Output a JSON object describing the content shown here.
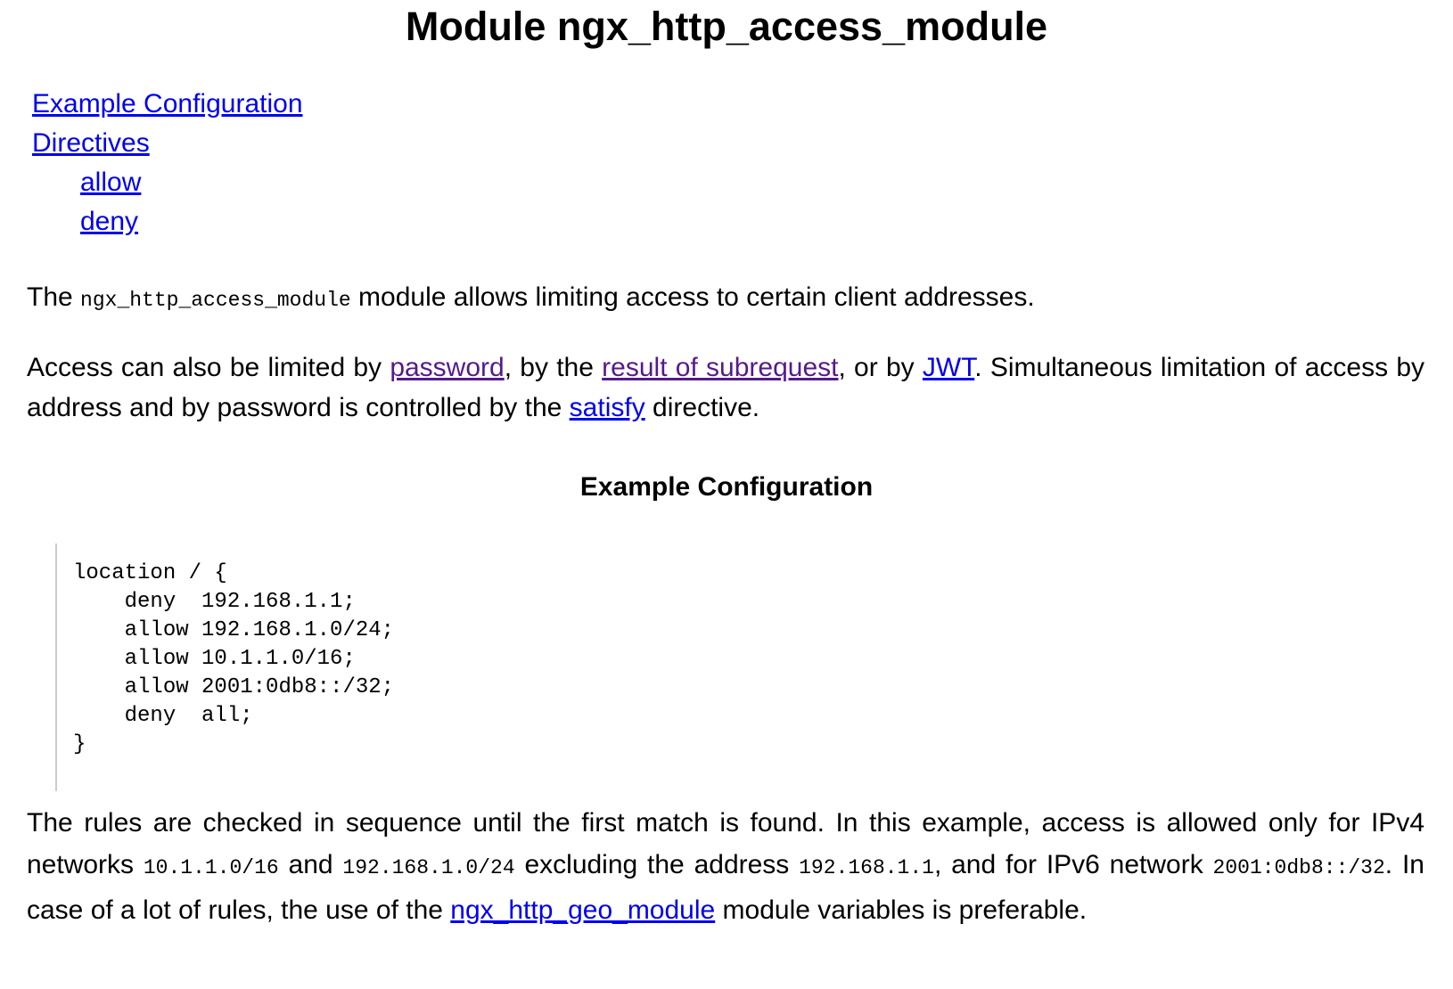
{
  "title": "Module ngx_http_access_module",
  "toc": {
    "example_configuration": "Example Configuration",
    "directives": "Directives",
    "allow": "allow",
    "deny": "deny"
  },
  "intro": {
    "before": "The ",
    "module_code": "ngx_http_access_module",
    "after": " module allows limiting access to certain client addresses."
  },
  "access_paragraph": {
    "t1": "Access can also be limited by ",
    "link_password": "password",
    "t2": ", by the ",
    "link_subrequest": "result of subrequest",
    "t3": ", or by ",
    "link_jwt": "JWT",
    "t4": ". Simultaneous limitation of access by address and by password is controlled by the ",
    "link_satisfy": "satisfy",
    "t5": " directive."
  },
  "example_heading": "Example Configuration",
  "code_example": "location / {\n    deny  192.168.1.1;\n    allow 192.168.1.0/24;\n    allow 10.1.1.0/16;\n    allow 2001:0db8::/32;\n    deny  all;\n}",
  "rules_paragraph": {
    "t1": "The rules are checked in sequence until the first match is found. In this example, access is allowed only for IPv4 networks ",
    "code1": "10.1.1.0/16",
    "t2": " and ",
    "code2": "192.168.1.0/24",
    "t3": " excluding the address ",
    "code3": "192.168.1.1",
    "t4": ", and for IPv6 network ",
    "code4": "2001:0db8::/32",
    "t5": ". In case of a lot of rules, the use of the ",
    "link_geo": "ngx_http_geo_module",
    "t6": " module variables is preferable."
  }
}
